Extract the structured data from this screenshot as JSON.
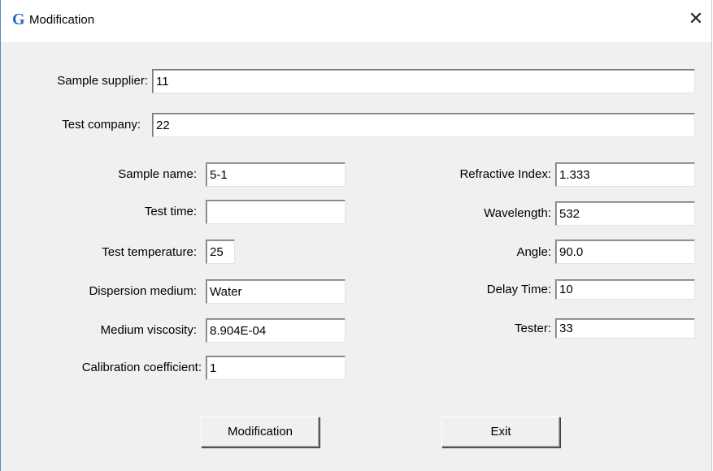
{
  "window": {
    "title": "Modification",
    "icon": "G",
    "close": "✕"
  },
  "form": {
    "sample_supplier": {
      "label": "Sample supplier:",
      "value": "11"
    },
    "test_company": {
      "label": "Test company:",
      "value": "22"
    },
    "sample_name": {
      "label": "Sample name:",
      "value": "5-1"
    },
    "test_time": {
      "label": "Test time:",
      "value": ""
    },
    "test_temperature": {
      "label": "Test temperature:",
      "value": "25"
    },
    "dispersion_medium": {
      "label": "Dispersion medium:",
      "value": "Water"
    },
    "medium_viscosity": {
      "label": "Medium viscosity:",
      "value": "8.904E-04"
    },
    "calibration_coefficient": {
      "label": "Calibration coefficient:",
      "value": "1"
    },
    "refractive_index": {
      "label": "Refractive Index:",
      "value": "1.333"
    },
    "wavelength": {
      "label": "Wavelength:",
      "value": "532"
    },
    "angle": {
      "label": "Angle:",
      "value": "90.0"
    },
    "delay_time": {
      "label": "Delay Time:",
      "value": "10"
    },
    "tester": {
      "label": "Tester:",
      "value": "33"
    }
  },
  "buttons": {
    "modification": "Modification",
    "exit": "Exit"
  }
}
